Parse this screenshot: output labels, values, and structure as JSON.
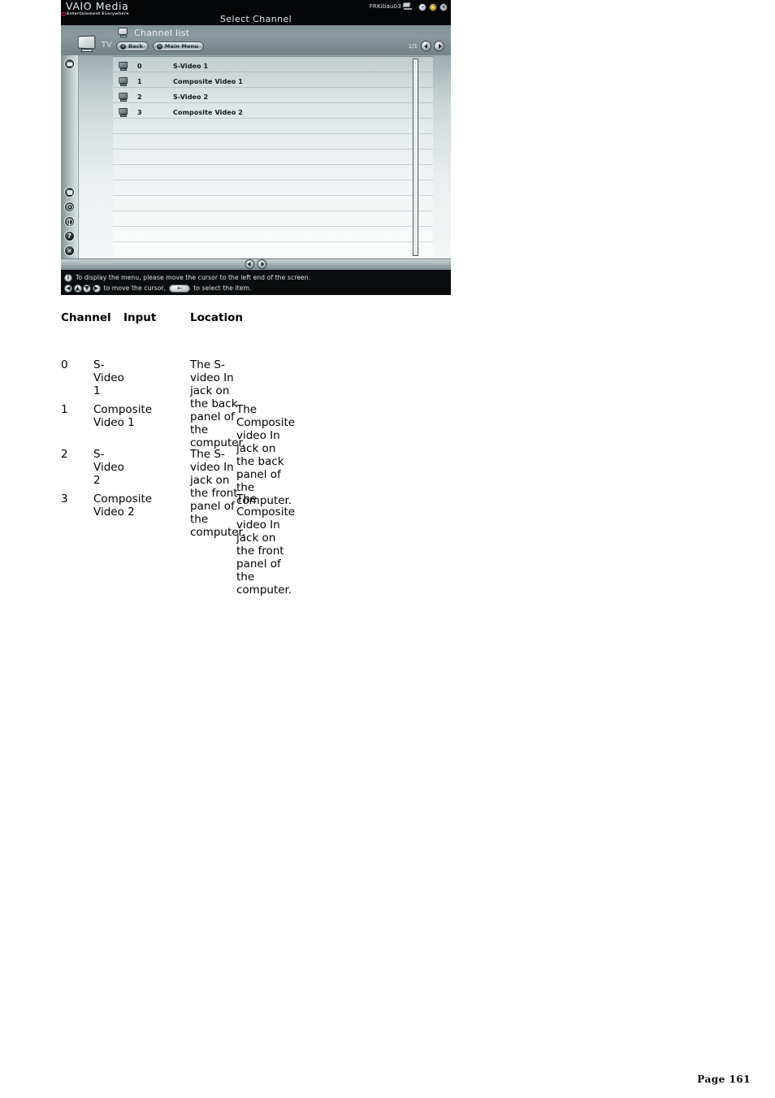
{
  "app": {
    "brand": "VAIO Media",
    "tagline": "Entertainment Everywhere",
    "screen_title": "Select Channel",
    "user_name": "FRKibau03",
    "window_buttons": [
      {
        "name": "minimize",
        "glyph": "–",
        "color": "#d8dde0"
      },
      {
        "name": "maximize",
        "glyph": "□",
        "color": "#e4a60a"
      },
      {
        "name": "close",
        "glyph": "×",
        "color": "#c3c9cd"
      }
    ],
    "toolbar": {
      "source_label": "TV",
      "section_label": "Channel list",
      "back_button": "Back",
      "main_menu_button": "Main Menu",
      "page_indicator": "1/1"
    },
    "rail_icons": [
      {
        "name": "tv-icon",
        "label": "TV"
      },
      {
        "name": "record-icon",
        "label": "Record"
      },
      {
        "name": "disc-icon",
        "label": "Disc"
      },
      {
        "name": "network-icon",
        "label": "Network"
      },
      {
        "name": "help-icon",
        "label": "?"
      },
      {
        "name": "exit-icon",
        "label": "×"
      }
    ],
    "channel_list": [
      {
        "number": "0",
        "name": "S-Video 1"
      },
      {
        "number": "1",
        "name": "Composite Video 1"
      },
      {
        "number": "2",
        "name": "S-Video 2"
      },
      {
        "number": "3",
        "name": "Composite Video 2"
      }
    ],
    "status": {
      "hint_key": "i",
      "hint_line": "To display the menu, please move the cursor to the left end of the screen.",
      "move_keys": [
        "◀",
        "▲",
        "▼",
        "▶"
      ],
      "move_text": "to move the cursor,",
      "select_text": "to select the item."
    }
  },
  "doc": {
    "headers": {
      "channel": "Channel",
      "input": "Input",
      "location": "Location"
    },
    "rows": [
      {
        "channel": "0",
        "input": "S-Video 1",
        "location": "The S-video In jack on the back panel of the computer."
      },
      {
        "channel": "1",
        "input": "Composite Video 1",
        "location": "The Composite video In jack on the back panel of the computer."
      },
      {
        "channel": "2",
        "input": "S-Video 2",
        "location": "The S-video In jack on the front panel of the computer."
      },
      {
        "channel": "3",
        "input": "Composite Video 2",
        "location": "The Composite video In jack on the front panel of the computer."
      }
    ],
    "page_footer": "Page 161"
  }
}
